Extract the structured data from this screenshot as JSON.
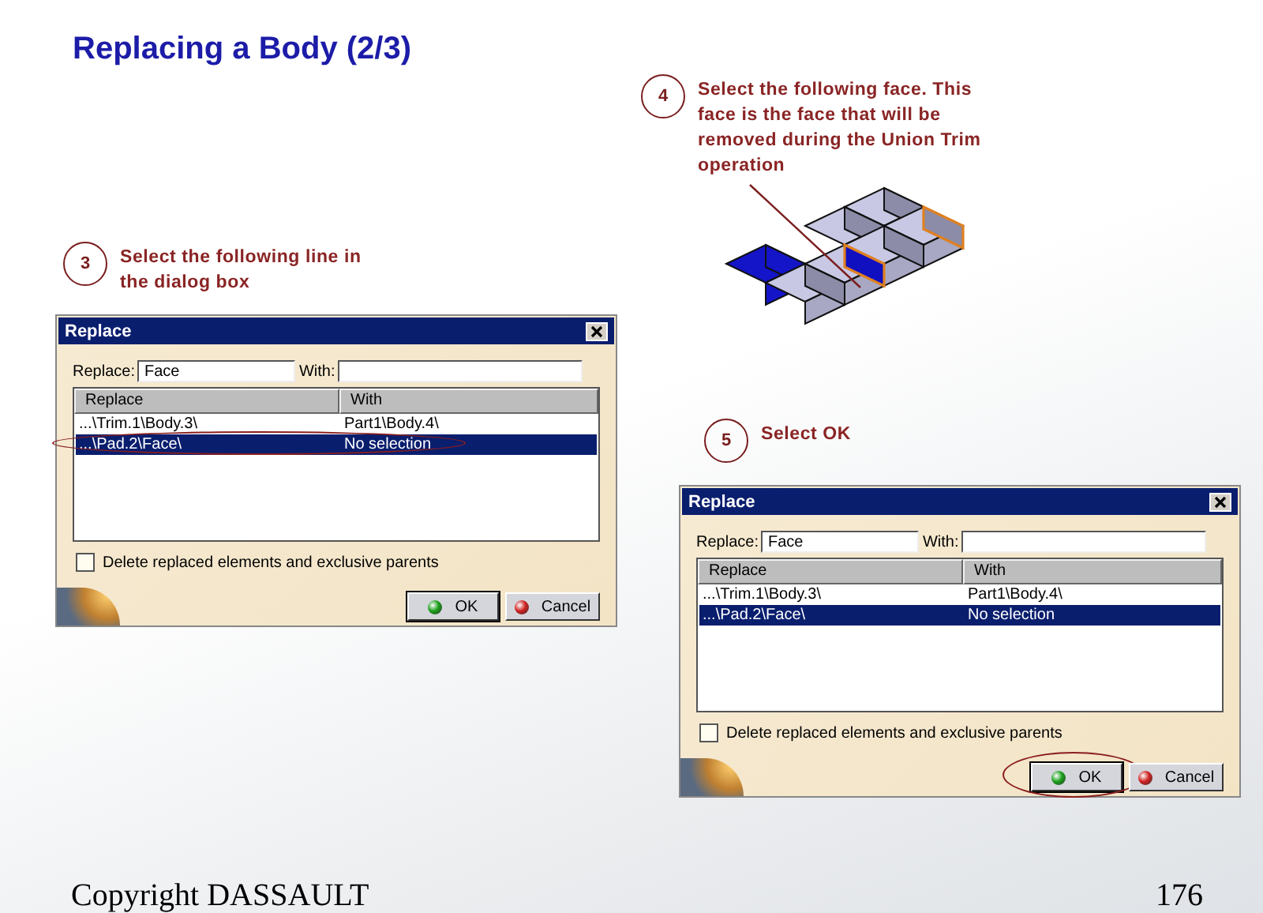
{
  "title": "Replacing a Body (2/3)",
  "steps": [
    {
      "number": "3",
      "text": "Select the following line in the dialog box"
    },
    {
      "number": "4",
      "text": "Select the following face. This face is the face that will be removed during the Union Trim operation"
    },
    {
      "number": "5",
      "text": "Select OK"
    }
  ],
  "dialogs": [
    {
      "title": "Replace",
      "replace_label": "Replace:",
      "replace_value": "Face",
      "with_label": "With:",
      "columns": [
        "Replace",
        "With"
      ],
      "rows": [
        {
          "cells": [
            "...\\Trim.1\\Body.3\\",
            "Part1\\Body.4\\"
          ],
          "selected": false,
          "circled": false
        },
        {
          "cells": [
            "...\\Pad.2\\Face\\",
            "No selection"
          ],
          "selected": true,
          "circled": true
        }
      ],
      "checkbox": {
        "label": "Delete replaced elements and exclusive parents",
        "checked": false
      },
      "buttons": [
        {
          "label": "OK",
          "kind": "ok",
          "circled": false
        },
        {
          "label": "Cancel",
          "kind": "cancel",
          "circled": false
        }
      ]
    },
    {
      "title": "Replace",
      "replace_label": "Replace:",
      "replace_value": "Face",
      "with_label": "With:",
      "columns": [
        "Replace",
        "With"
      ],
      "rows": [
        {
          "cells": [
            "...\\Trim.1\\Body.3\\",
            "Part1\\Body.4\\"
          ],
          "selected": false,
          "circled": false
        },
        {
          "cells": [
            "...\\Pad.2\\Face\\",
            "No selection"
          ],
          "selected": true,
          "circled": false
        }
      ],
      "checkbox": {
        "label": "Delete replaced elements and exclusive parents",
        "checked": false
      },
      "buttons": [
        {
          "label": "OK",
          "kind": "ok",
          "circled": true
        },
        {
          "label": "Cancel",
          "kind": "cancel",
          "circled": false
        }
      ]
    }
  ],
  "footer": {
    "copyright": "Copyright DASSAULT",
    "page": "176"
  }
}
